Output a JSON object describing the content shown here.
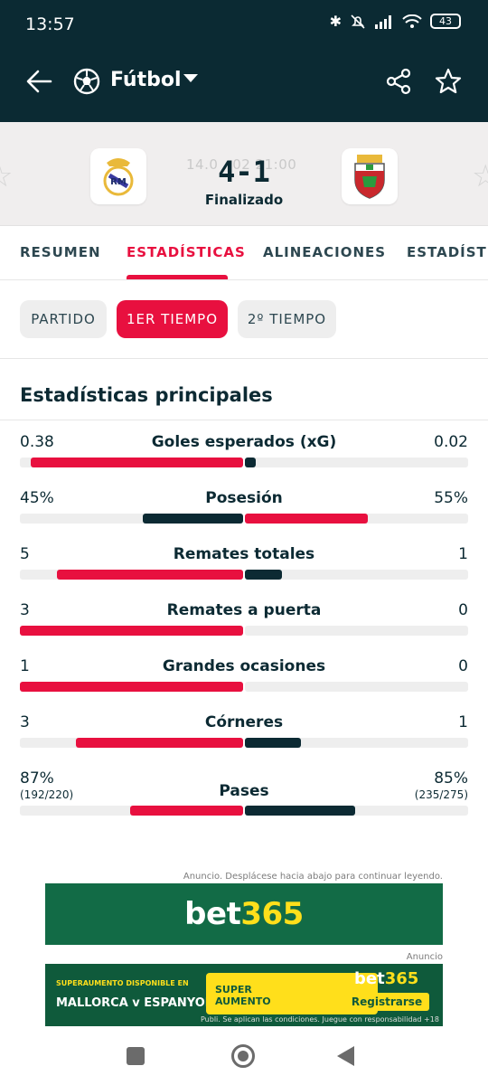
{
  "status_bar": {
    "time": "13:57",
    "battery": "43"
  },
  "nav": {
    "title": "Fútbol"
  },
  "match": {
    "faded_datetime": "14.0 . 02 21:00",
    "score": "4-1",
    "state": "Finalizado"
  },
  "tabs": [
    "RESUMEN",
    "ESTADÍSTICAS",
    "ALINEACIONES",
    "ESTADÍSTIC"
  ],
  "active_tab": 1,
  "segments": [
    "PARTIDO",
    "1ER TIEMPO",
    "2º TIEMPO"
  ],
  "active_segment": 1,
  "section_title": "Estadísticas principales",
  "colors": {
    "home": "#e8103f",
    "away": "#0c2a33",
    "accent": "#e8103f",
    "header_bg": "#0b2a33"
  },
  "stats": [
    {
      "name": "Goles esperados (xG)",
      "home": "0.38",
      "away": "0.02",
      "home_share": 0.95,
      "away_share": 0.05,
      "home_sub": "",
      "away_sub": ""
    },
    {
      "name": "Posesión",
      "home": "45%",
      "away": "55%",
      "home_share": 0.45,
      "away_share": 0.55,
      "home_sub": "",
      "away_sub": ""
    },
    {
      "name": "Remates totales",
      "home": "5",
      "away": "1",
      "home_share": 0.833,
      "away_share": 0.167,
      "home_sub": "",
      "away_sub": ""
    },
    {
      "name": "Remates a puerta",
      "home": "3",
      "away": "0",
      "home_share": 1.0,
      "away_share": 0.0,
      "home_sub": "",
      "away_sub": ""
    },
    {
      "name": "Grandes ocasiones",
      "home": "1",
      "away": "0",
      "home_share": 1.0,
      "away_share": 0.0,
      "home_sub": "",
      "away_sub": ""
    },
    {
      "name": "Córneres",
      "home": "3",
      "away": "1",
      "home_share": 0.75,
      "away_share": 0.25,
      "home_sub": "",
      "away_sub": ""
    },
    {
      "name": "Pases",
      "home": "87%",
      "away": "85%",
      "home_share": 0.506,
      "away_share": 0.494,
      "home_sub": "(192/220)",
      "away_sub": "(235/275)"
    }
  ],
  "ads": {
    "note1": "Anuncio. Desplácese hacia abajo para continuar leyendo.",
    "banner1_text_a": "bet",
    "banner1_text_b": "365",
    "note2": "Anuncio",
    "banner2_promo": "SUPERAUMENTO DISPONIBLE EN",
    "banner2_match": "MALLORCA v ESPANYOL",
    "banner2_super_a": "SUPER",
    "banner2_super_b": "AUMENTO",
    "banner2_brand_a": "bet",
    "banner2_brand_b": "365",
    "banner2_cta": "Registrarse",
    "banner2_legal": "Publi. Se aplican las condiciones. Juegue con responsabilidad +18"
  }
}
